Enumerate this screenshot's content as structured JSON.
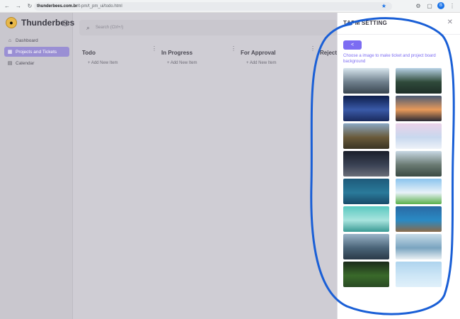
{
  "browser": {
    "url_host": "thunderbees.com.br",
    "url_path": "/t-pm/t_pm_ui/todo.html",
    "profile_initial": "B"
  },
  "sidebar": {
    "brand": "Thunderbees",
    "items": [
      {
        "label": "Dashboard",
        "icon": "home-icon"
      },
      {
        "label": "Projects and Tickets",
        "icon": "projects-icon"
      },
      {
        "label": "Calendar",
        "icon": "calendar-icon"
      }
    ]
  },
  "search": {
    "placeholder": "Search (Ctrl+/)"
  },
  "board": {
    "add_label": "+ Add New Item",
    "columns": [
      "Todo",
      "In Progress",
      "For Approval",
      "Rejected"
    ]
  },
  "panel": {
    "title": "T&PM SETTING",
    "back_label": "<",
    "description": "Choose a image to make ticket and project board background",
    "backgrounds": [
      {
        "name": "road-winter",
        "colors": [
          "#d8e6ee",
          "#6e7f8c",
          "#3a4650"
        ]
      },
      {
        "name": "forest-road",
        "colors": [
          "#b8d2e6",
          "#2f4a3a",
          "#1e2e28"
        ]
      },
      {
        "name": "starry-sky",
        "colors": [
          "#0d1d4a",
          "#3a5aa8",
          "#1a2a5c"
        ]
      },
      {
        "name": "sunset-mountain",
        "colors": [
          "#4a5a74",
          "#e89a5a",
          "#2a2a34"
        ]
      },
      {
        "name": "valley-cliffs",
        "colors": [
          "#8aa8c4",
          "#6a5a3a",
          "#3a3424"
        ]
      },
      {
        "name": "pink-snow",
        "colors": [
          "#ead2e8",
          "#c8d8ee",
          "#eef2f8"
        ]
      },
      {
        "name": "night-mountains",
        "colors": [
          "#1a1e2a",
          "#3a4254",
          "#6a6e78"
        ]
      },
      {
        "name": "mountain-lake",
        "colors": [
          "#c8d8e4",
          "#6a7a72",
          "#3a4a44"
        ]
      },
      {
        "name": "blue-moon",
        "colors": [
          "#1e5a7a",
          "#2a7a9a",
          "#1a4a68"
        ]
      },
      {
        "name": "green-hills",
        "colors": [
          "#8ac4ee",
          "#e8f2f8",
          "#5ab04a"
        ]
      },
      {
        "name": "teal-water",
        "colors": [
          "#5ac8c0",
          "#a8e4de",
          "#3a9a94"
        ]
      },
      {
        "name": "blue-coast",
        "colors": [
          "#2a6aa4",
          "#2a8ac4",
          "#8a6a4a"
        ]
      },
      {
        "name": "lake-road",
        "colors": [
          "#9ab4c8",
          "#4a6478",
          "#2a3a48"
        ]
      },
      {
        "name": "blue-dunes",
        "colors": [
          "#c8dce8",
          "#7aa4c0",
          "#eaf0f4"
        ]
      },
      {
        "name": "green-field",
        "colors": [
          "#1a2a1a",
          "#3a6a2a",
          "#2a4a24"
        ]
      },
      {
        "name": "light-blue-sky",
        "colors": [
          "#aed4ee",
          "#cde6f6",
          "#e0f0fa"
        ]
      }
    ]
  }
}
